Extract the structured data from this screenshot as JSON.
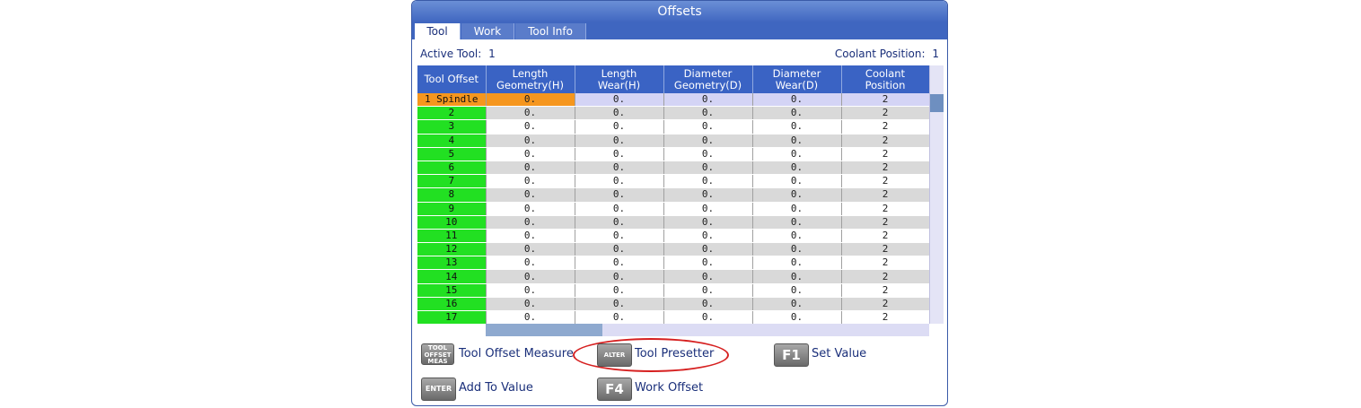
{
  "window": {
    "title": "Offsets"
  },
  "tabs": [
    {
      "label": "Tool",
      "active": true
    },
    {
      "label": "Work",
      "active": false
    },
    {
      "label": "Tool Info",
      "active": false
    }
  ],
  "info": {
    "active_tool_label": "Active Tool:",
    "active_tool_value": "1",
    "coolant_position_label": "Coolant Position:",
    "coolant_position_value": "1"
  },
  "table": {
    "headers": [
      [
        "Tool Offset"
      ],
      [
        "Length",
        "Geometry(H)"
      ],
      [
        "Length",
        "Wear(H)"
      ],
      [
        "Diameter",
        "Geometry(D)"
      ],
      [
        "Diameter",
        "Wear(D)"
      ],
      [
        "Coolant",
        "Position"
      ]
    ],
    "rows": [
      [
        "1 Spindle",
        "0.",
        "0.",
        "0.",
        "0.",
        "2"
      ],
      [
        "2",
        "0.",
        "0.",
        "0.",
        "0.",
        "2"
      ],
      [
        "3",
        "0.",
        "0.",
        "0.",
        "0.",
        "2"
      ],
      [
        "4",
        "0.",
        "0.",
        "0.",
        "0.",
        "2"
      ],
      [
        "5",
        "0.",
        "0.",
        "0.",
        "0.",
        "2"
      ],
      [
        "6",
        "0.",
        "0.",
        "0.",
        "0.",
        "2"
      ],
      [
        "7",
        "0.",
        "0.",
        "0.",
        "0.",
        "2"
      ],
      [
        "8",
        "0.",
        "0.",
        "0.",
        "0.",
        "2"
      ],
      [
        "9",
        "0.",
        "0.",
        "0.",
        "0.",
        "2"
      ],
      [
        "10",
        "0.",
        "0.",
        "0.",
        "0.",
        "2"
      ],
      [
        "11",
        "0.",
        "0.",
        "0.",
        "0.",
        "2"
      ],
      [
        "12",
        "0.",
        "0.",
        "0.",
        "0.",
        "2"
      ],
      [
        "13",
        "0.",
        "0.",
        "0.",
        "0.",
        "2"
      ],
      [
        "14",
        "0.",
        "0.",
        "0.",
        "0.",
        "2"
      ],
      [
        "15",
        "0.",
        "0.",
        "0.",
        "0.",
        "2"
      ],
      [
        "16",
        "0.",
        "0.",
        "0.",
        "0.",
        "2"
      ],
      [
        "17",
        "0.",
        "0.",
        "0.",
        "0.",
        "2"
      ]
    ]
  },
  "softkeys": {
    "tool_offset_meas": {
      "key_lines": [
        "TOOL",
        "OFFSET",
        "MEAS"
      ],
      "label": "Tool Offset Measure"
    },
    "alter": {
      "key": "ALTER",
      "label": "Tool Presetter"
    },
    "f1": {
      "key": "F1",
      "label": "Set Value"
    },
    "enter": {
      "key": "ENTER",
      "label": "Add To Value"
    },
    "f4": {
      "key": "F4",
      "label": "Work Offset"
    }
  },
  "colors": {
    "header_blue": "#3a63c4",
    "index_green": "#22e022",
    "selected_orange": "#f5961e",
    "highlight_ring": "#d62020"
  }
}
